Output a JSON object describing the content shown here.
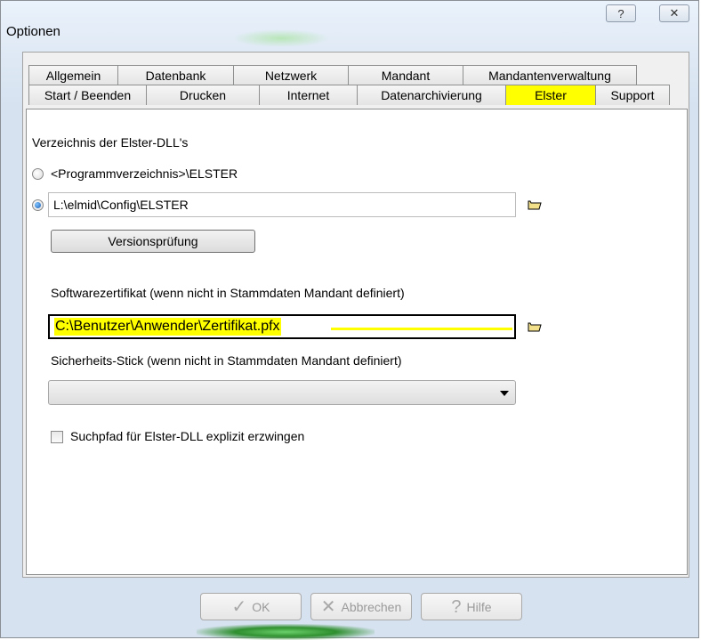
{
  "window": {
    "title": "Optionen",
    "help_icon": "?",
    "close_icon": "✕"
  },
  "tabs": {
    "row1": [
      "Allgemein",
      "Datenbank",
      "Netzwerk",
      "Mandant",
      "Mandantenverwaltung"
    ],
    "row2": [
      "Start / Beenden",
      "Drucken",
      "Internet",
      "Datenarchivierung",
      "Elster",
      "Support"
    ],
    "active": "Elster"
  },
  "elster": {
    "dll_heading": "Verzeichnis der Elster-DLL's",
    "radio_program_label": "<Programmverzeichnis>\\ELSTER",
    "radio_custom_value": "L:\\elmid\\Config\\ELSTER",
    "version_button": "Versionsprüfung",
    "cert_label": "Softwarezertifikat (wenn nicht in Stammdaten Mandant definiert)",
    "cert_value": "C:\\Benutzer\\Anwender\\Zertifikat.pfx",
    "stick_label": "Sicherheits-Stick (wenn nicht in Stammdaten Mandant definiert)",
    "stick_value": "",
    "force_path_label": "Suchpfad für Elster-DLL explizit erzwingen"
  },
  "footer": {
    "ok": "OK",
    "cancel": "Abbrechen",
    "help": "Hilfe"
  },
  "icons": {
    "folder": "folder-open-icon",
    "ok": "checkmark-icon",
    "cancel": "cross-icon",
    "help": "question-icon"
  },
  "colors": {
    "highlight": "#ffff00",
    "tab_bg": "#f0f0f0"
  }
}
